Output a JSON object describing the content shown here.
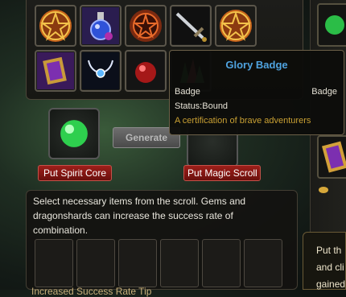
{
  "tooltip": {
    "title": "Glory Badge",
    "type_left": "Badge",
    "type_right": "Badge",
    "status": "Status:Bound",
    "description": "A certification of brave adventurers"
  },
  "crafting": {
    "generate_label": "Generate",
    "put_spirit_core_label": "Put Spirit Core",
    "put_magic_scroll_label": "Put Magic Scroll",
    "instructions": "Select necessary items from the scroll. Gems and dragonshards can increase the success rate of combination.",
    "bottom_partial": "Increased Success Rate Tip"
  },
  "right_panel": {
    "line1": "Put th",
    "line2": "and cli",
    "line3": "gained"
  },
  "inventory_icons": [
    "pentagram-medallion-icon",
    "blue-potion-flask-icon",
    "dark-pentagram-medallion-icon",
    "sword-icon",
    "pentagram-medallion-icon",
    "magic-scroll-icon",
    "white-necklace-icon",
    "red-orb-icon",
    "crystal-cluster-icon"
  ],
  "colors": {
    "tooltip_title": "#4fa3e0",
    "tooltip_desc": "#c9a033",
    "red_button": "#8a1812"
  }
}
